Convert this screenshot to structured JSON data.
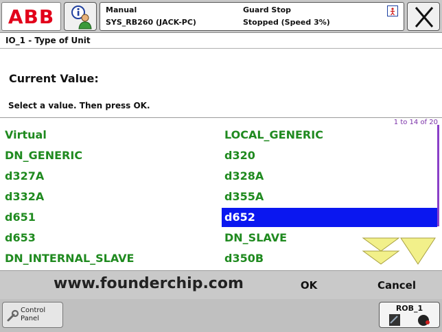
{
  "brand": {
    "logo_text": "ABB",
    "accent_color": "#e2001a"
  },
  "status": {
    "mode": "Manual",
    "system": "SYS_RB260 (JACK-PC)",
    "guard": "Guard Stop",
    "state": "Stopped (Speed 3%)"
  },
  "view": {
    "title": "IO_1 - Type of Unit",
    "current_value_label": "Current Value:",
    "instructions": "Select a value. Then press OK."
  },
  "list": {
    "page_indicator": "1 to 14 of 20",
    "selected": "d652",
    "items": [
      "Virtual",
      "LOCAL_GENERIC",
      "DN_GENERIC",
      "d320",
      "d327A",
      "d328A",
      "d332A",
      "d355A",
      "d651",
      "d652",
      "d653",
      "DN_SLAVE",
      "DN_INTERNAL_SLAVE",
      "d350B"
    ]
  },
  "commands": {
    "watermark": "www.founderchip.com",
    "ok_label": "OK",
    "cancel_label": "Cancel"
  },
  "taskbar": {
    "control_panel_label_1": "Control",
    "control_panel_label_2": "Panel",
    "rob_label": "ROB_1"
  },
  "icons": {
    "info": "info-user-icon",
    "close": "close-x-icon",
    "scroll_down": "chevron-double-down-icon",
    "page_down": "triangle-down-icon",
    "wrench": "wrench-icon",
    "robot": "robot-joint-icon"
  }
}
